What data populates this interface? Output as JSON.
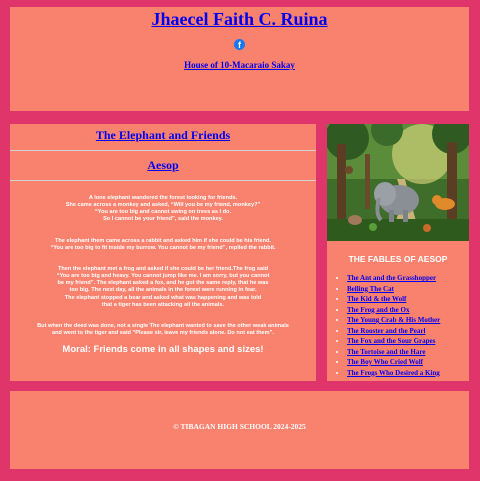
{
  "header": {
    "name": "Jhaecel Faith C. Ruina",
    "social_icon": "facebook-icon",
    "house": "House of 10-Macaraio Sakay"
  },
  "story": {
    "title": "The Elephant and Friends",
    "author": "Aesop",
    "paragraphs": [
      [
        "A lone elephant wandered the forest looking for friends.",
        "She came across a monkey and asked, “Will you be my friend, monkey?”",
        "“You are too big and cannot swing on trees as I do.",
        "So I cannot be your friend”, said the monkey."
      ],
      [
        "The elephant them came across a rabbit and asked him if she could be his friend.",
        "“You are too big to fit inside my burrow. You cannot be my friend”, replied the rabbit."
      ],
      [
        "Then the elephant met a frog and asked if she could be her friend.The frog said",
        "“You are too big and heavy. You cannot jump like me. I am sorry, but you cannot",
        "be my friend”. The elephant asked a fox, and he got the same reply, that he was",
        "too big. The next day, all the animals in the forest were running in fear.",
        "The elephant stopped a bear and asked what was happening and was told",
        "that a tiger has been attacking all the animals."
      ],
      [
        "But when the deed was done, not a single The elephant wanted to save the other weak animals",
        "and went to the tiger and said “Please sir, leave my friends alone. Do not eat them”."
      ]
    ],
    "moral": "Moral: Friends come in all shapes and sizes!"
  },
  "sidebar": {
    "title": "THE FABLES OF AESOP",
    "fables": [
      "The Ant and the Grasshopper",
      "Belling The Cat",
      "The Kid & the Wolf",
      "The Frog and the Ox",
      "The Young Crab & His Mother",
      "The Rooster and the Pearl",
      "The Fox and the Sour Grapes",
      "The Tortoise and the Hare",
      "The Boy Who Cried Wolf",
      "The Frogs Who Desired a King"
    ]
  },
  "footer": {
    "copyright": "© TIBAGAN HIGH SCHOOL 2024-2025"
  },
  "colors": {
    "background": "#e0356b",
    "panel": "#f9826f",
    "link": "#0000ee"
  }
}
